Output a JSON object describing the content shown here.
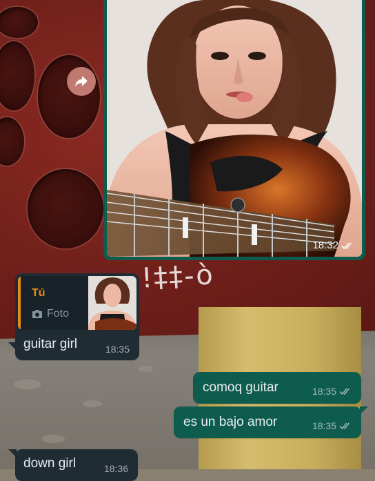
{
  "image_message": {
    "time": "18:32",
    "status": "read"
  },
  "reply_message": {
    "quote_author": "Tú",
    "quote_type": "Foto",
    "text": "guitar girl",
    "time": "18:35"
  },
  "out_messages": [
    {
      "text": "comoq guitar",
      "time": "18:35",
      "status": "read"
    },
    {
      "text": "es un bajo amor",
      "time": "18:35",
      "status": "read"
    }
  ],
  "partial_message": {
    "text": "down girl",
    "time": "18:36"
  },
  "wallpaper": {
    "graffiti": "!‡‡-ò"
  },
  "colors": {
    "outgoing_bubble": "#0d5c4d",
    "incoming_bubble": "#1f2c33",
    "quote_accent": "#e88a1a",
    "forward_button": "#c07a72"
  },
  "icons": {
    "forward": "forward-arrow-icon",
    "read_receipt": "double-check-icon",
    "camera": "camera-icon"
  }
}
